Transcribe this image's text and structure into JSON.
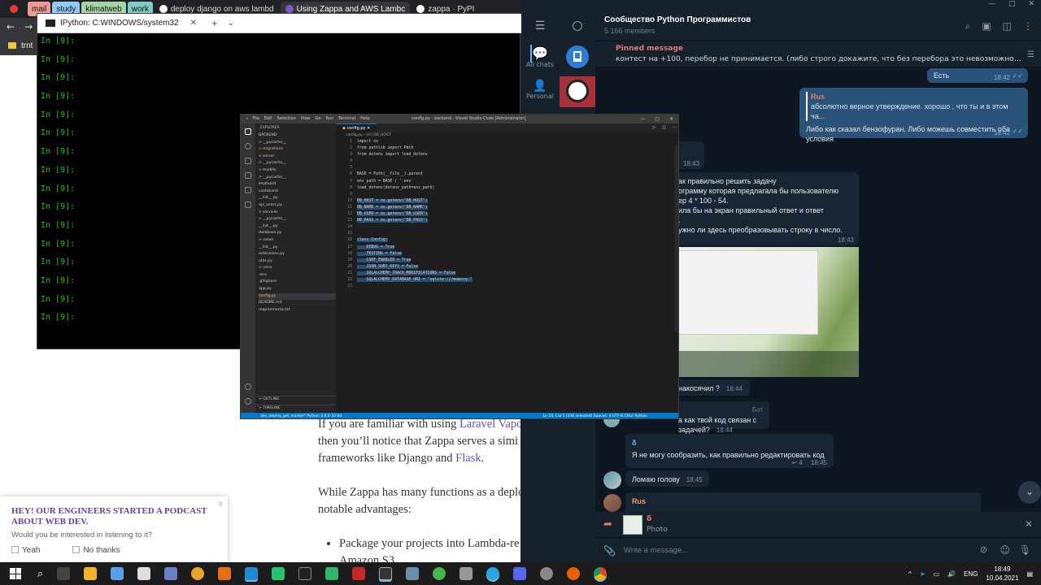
{
  "browser": {
    "tabs": [
      {
        "label": "",
        "color": "#e53935",
        "group": false
      },
      {
        "label": "mail",
        "color": "#ef9a9a",
        "group": true
      },
      {
        "label": "study",
        "color": "#90caf9",
        "group": true
      },
      {
        "label": "klimatweb",
        "color": "#a5d6a7",
        "group": true
      },
      {
        "label": "work",
        "color": "#80cbc4",
        "group": true
      },
      {
        "label": "deploy django on aws lambd",
        "color": "#ffffff",
        "group": false
      },
      {
        "label": "Using Zappa and AWS Lambc",
        "color": "#7e57c2",
        "group": false,
        "active": true
      },
      {
        "label": "zappa · PyPI",
        "color": "#ffffff",
        "group": false
      }
    ],
    "bookmark": "trnt",
    "article": {
      "line1_prefix": "If you are familiar with using ",
      "line1_link": "Laravel Vapo",
      "line2": "then you’ll notice that Zappa serves a simi",
      "line3_prefix": "frameworks like Django and ",
      "line3_link": "Flask",
      "line3_suffix": ".",
      "para2_line1": "While Zappa has many functions as a deplo",
      "para2_line2": "notable advantages:",
      "bullet": "Package your projects into Lambda-re",
      "bullet_cont": "Amazon S3"
    },
    "podcast": {
      "title": "HEY! OUR ENGINEERS STARTED A PODCAST ABOUT WEB DEV.",
      "question": "Would you be interested in listening to it?",
      "yes": "Yeah",
      "no": "No thanks",
      "close": "x"
    }
  },
  "console": {
    "title": "IPython: C:WINDOWS/system32",
    "prompt": "In [9]:",
    "lines": [
      "In [9]:",
      "In [9]:",
      "In [9]:",
      "In [9]:",
      "In [9]:",
      "In [9]:",
      "In [9]:",
      "In [9]:",
      "In [9]:",
      "In [9]:",
      "In [9]:",
      "In [9]:",
      "In [9]:",
      "In [9]:",
      "In [9]:",
      "In [9]:"
    ]
  },
  "vscode": {
    "menu": [
      "File",
      "Edit",
      "Selection",
      "View",
      "Go",
      "Run",
      "Terminal",
      "Help"
    ],
    "window_title": "config.py - backend - Visual Studio Code [Administrator]",
    "tab": "config.py",
    "breadcrumb": "config.py › [∅] DB_HOST",
    "explorer_title": "EXPLORER",
    "tree": [
      "BACKEND",
      "  > __pycache__",
      "  > migrations",
      "  ∨ server",
      "    > __pycache__",
      "    ∨ models",
      "      > __pycache__",
      "        keyboard",
      "        vostokand",
      "        __init__.py",
      "        api_users.py",
      "    ∨ services",
      "      > __pycache__",
      "        __init__.py",
      "        database.py",
      "    > views",
      "      __init__.py",
      "      extensions.py",
      "      utils.py",
      "  > venv",
      "  .env",
      "  .gitignore",
      "  app.py",
      "  config.py",
      "  README.md",
      "  requirements.txt"
    ],
    "outline": "> OUTLINE",
    "timeline": "> TIMELINE",
    "code": [
      "import os",
      "from pathlib import Path",
      "from dotenv import load_dotenv",
      "",
      "",
      "BASE = Path(__file__).parent",
      "env_path = BASE / '.env'",
      "load_dotenv(dotenv_path=env_path)",
      "",
      "DB_HOST = os.getenv(\"DB_HOST\")",
      "DB_NAME = os.getenv(\"DB_NAME\")",
      "DB_USER = os.getenv(\"DB_USER\")",
      "DB_PASS = os.getenv(\"DB_PASS\")",
      "",
      "",
      "class Config:",
      "    DEBUG = True",
      "    TESTING = False",
      "    CSRF_ENABLED = True",
      "    JSON_SORT_KEYS = False",
      "    SQLALCHEMY_TRACK_MODIFICATIONS = False",
      "    SQLALCHEMY_DATABASE_URI = \"sqlite:///memory:\"",
      ""
    ],
    "status_left": "dev_deploy_get_marker*   Python 3.8.0 32-bit",
    "status_right": "Ln 10, Col 1 (336 selected)   Spaces: 4   UTF-8   CRLF   Python"
  },
  "telegram": {
    "title": "Сообщество Python Программистов",
    "members": "5 166 members",
    "nav_chats": "All chats",
    "nav_personal": "Personal",
    "pinned_label": "Pinned message",
    "pinned_text": "контест на +100, перебор не принимается. (либо строго докажите, что без перебора это невозможно)  есть условно ...",
    "messages": {
      "m1": {
        "text": "Есть",
        "time": "18:42"
      },
      "m2": {
        "sender": "Rus",
        "quote": "абсолютно верное утверждение. хорошо , что ты и в этом ча...",
        "text": "Либо как сказал бензофуран. Либо можешь совместить оба условия",
        "time": "18:42"
      },
      "m3": {
        "time": "18:43"
      },
      "m4": {
        "lines": [
          "ак правильно решить задачу",
          "ограмму которая предлагала бы пользователю",
          "ер 4 * 100 - 54.",
          "ила бы на экран правильный ответ и ответ",
          ".",
          "ужно ли здесь преобразовывать строку в число."
        ],
        "time": "18:43"
      },
      "m5": {
        "text": "накосячил ?",
        "time": "18:44"
      },
      "m6": {
        "badge": "Бот",
        "text": "а как твой код связан с задачей?",
        "time": "18:44"
      },
      "m7": {
        "sender": "δ",
        "text": "Я не могу сообразить, как правильно редактировать код",
        "replies": "4",
        "time": "18:45"
      },
      "m8": {
        "text": "Ломаю голову",
        "time": "18:45"
      },
      "m9": {
        "sender": "Rus"
      }
    },
    "reply_sender": "δ",
    "reply_type": "Photo",
    "placeholder": "Write a message..."
  },
  "taskbar": {
    "lang": "ENG",
    "time": "18:49",
    "date": "10.04.2021"
  }
}
